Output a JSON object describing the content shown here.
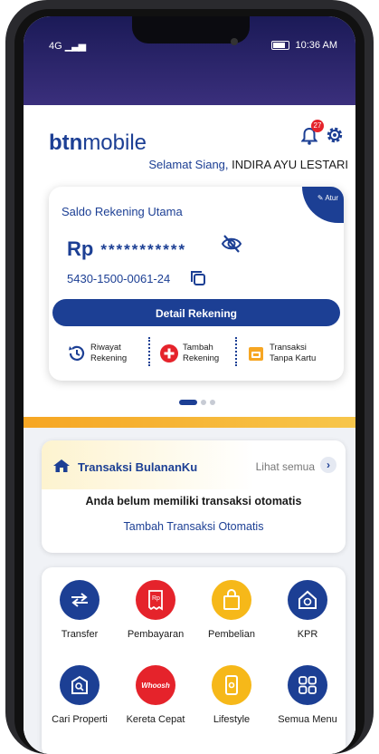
{
  "status_bar": {
    "signal": "4G",
    "time": "10:36 AM"
  },
  "header": {
    "logo_part1": "btn",
    "logo_part2": "mobile",
    "notification_count": "27",
    "greeting": "Selamat Siang,",
    "user_name": "INDIRA AYU LESTARI"
  },
  "account_card": {
    "title": "Saldo Rekening Utama",
    "currency": "Rp",
    "masked_balance": "***********",
    "account_number": "5430-1500-0061-24",
    "atur_label": "Atur",
    "detail_button": "Detail Rekening",
    "quick_actions": [
      {
        "line1": "Riwayat",
        "line2": "Rekening",
        "icon": "history-icon"
      },
      {
        "line1": "Tambah",
        "line2": "Rekening",
        "icon": "plus-circle-icon"
      },
      {
        "line1": "Transaksi",
        "line2": "Tanpa Kartu",
        "icon": "cardless-icon"
      }
    ]
  },
  "carousel": {
    "pages": 3,
    "active": 0
  },
  "transaksi": {
    "title": "Transaksi BulananKu",
    "see_all": "Lihat semua",
    "empty_text": "Anda belum memiliki transaksi otomatis",
    "add_link": "Tambah Transaksi Otomatis"
  },
  "menu": {
    "items": [
      {
        "label": "Transfer",
        "color": "#1c3f94",
        "icon": "transfer-icon"
      },
      {
        "label": "Pembayaran",
        "color": "#e5232b",
        "icon": "payment-icon"
      },
      {
        "label": "Pembelian",
        "color": "#f6b819",
        "icon": "shopping-bag-icon"
      },
      {
        "label": "KPR",
        "color": "#1c3f94",
        "icon": "house-loan-icon"
      },
      {
        "label": "Cari Properti",
        "color": "#1c3f94",
        "icon": "property-search-icon"
      },
      {
        "label": "Kereta Cepat",
        "color": "#e5232b",
        "icon": "train-icon",
        "logo_text": "Whoosh"
      },
      {
        "label": "Lifestyle",
        "color": "#f6b819",
        "icon": "lifestyle-phone-icon"
      },
      {
        "label": "Semua Menu",
        "color": "#1c3f94",
        "icon": "grid-menu-icon"
      }
    ]
  },
  "colors": {
    "primary": "#1c3f94",
    "accent_red": "#e5232b",
    "accent_yellow": "#f6b819"
  }
}
